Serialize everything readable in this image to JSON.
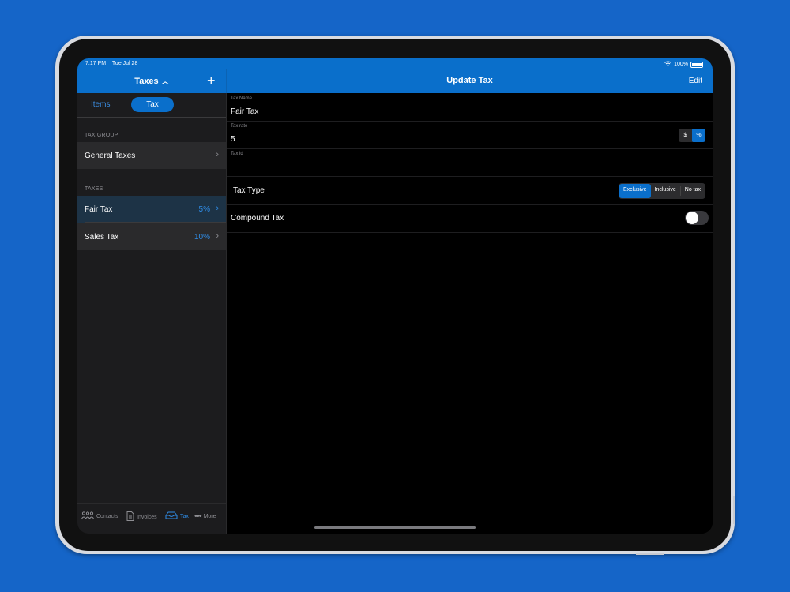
{
  "status_bar": {
    "time": "7:17 PM",
    "date": "Tue Jul 28",
    "battery": "100%"
  },
  "sidebar": {
    "title": "Taxes",
    "tabs": {
      "items": "Items",
      "tax": "Tax"
    },
    "tax_group_label": "TAX GROUP",
    "tax_group_row": "General Taxes",
    "taxes_label": "TAXES",
    "taxes": [
      {
        "name": "Fair Tax",
        "value": "5%"
      },
      {
        "name": "Sales Tax",
        "value": "10%"
      }
    ]
  },
  "tabbar": {
    "contacts": "Contacts",
    "invoices": "Invoices",
    "tax": "Tax",
    "more": "More"
  },
  "detail": {
    "title": "Update Tax",
    "edit_label": "Edit",
    "tax_name_label": "Tax Name",
    "tax_name_value": "Fair Tax",
    "tax_rate_label": "Tax rate",
    "tax_rate_value": "5",
    "unit_dollar": "$",
    "unit_percent": "%",
    "selected_unit": "%",
    "tax_id_label": "Tax id",
    "tax_id_value": "",
    "tax_type_label": "Tax Type",
    "tax_type_options": [
      "Exclusive",
      "Inclusive",
      "No tax"
    ],
    "tax_type_selected": "Exclusive",
    "compound_label": "Compound Tax",
    "compound_on": false
  },
  "colors": {
    "accent": "#0a6fcb",
    "background": "#1565c8"
  }
}
